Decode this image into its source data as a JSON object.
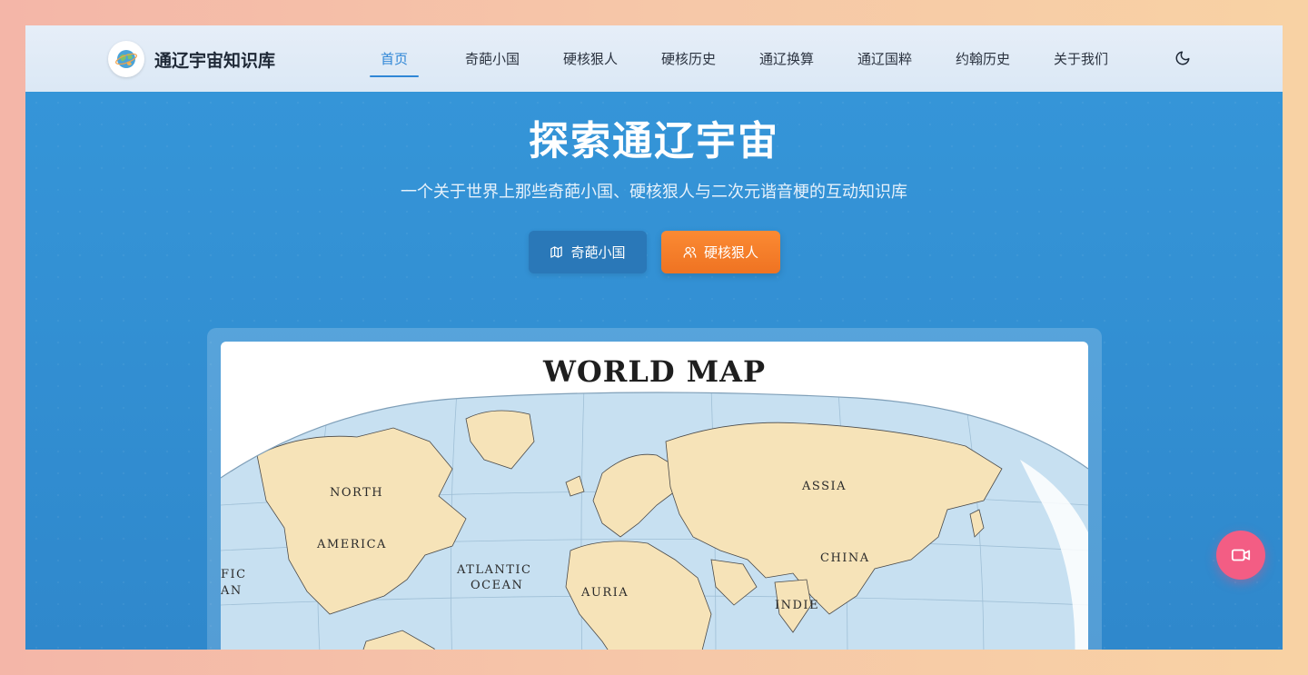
{
  "header": {
    "brand": "通辽宇宙知识库",
    "nav": [
      {
        "label": "首页",
        "active": true
      },
      {
        "label": "奇葩小国"
      },
      {
        "label": "硬核狠人"
      },
      {
        "label": "硬核历史"
      },
      {
        "label": "通辽换算"
      },
      {
        "label": "通辽国粹"
      },
      {
        "label": "约翰历史"
      },
      {
        "label": "关于我们"
      }
    ],
    "theme_icon": "moon-icon"
  },
  "hero": {
    "title": "探索通辽宇宙",
    "subtitle": "一个关于世界上那些奇葩小国、硬核狠人与二次元谐音梗的互动知识库",
    "buttons": {
      "primary": {
        "label": "奇葩小国",
        "icon": "map-icon"
      },
      "accent": {
        "label": "硬核狠人",
        "icon": "users-icon"
      }
    }
  },
  "map": {
    "title": "WORLD MAP",
    "labels": {
      "north": "NORTH",
      "america": "AMERICA",
      "atlantic": "ATLANTIC",
      "ocean": "OCEAN",
      "pacific_partial": "FIC",
      "pacific_ocean_partial": "AN",
      "auoria": "AURIA",
      "assia": "ASSIA",
      "china": "CHINA",
      "indie": "INDIE"
    }
  },
  "floating": {
    "icon": "video-camera-icon"
  },
  "colors": {
    "accent_blue": "#2f86d6",
    "accent_orange": "#f57d2a",
    "float_pink": "#f35d84",
    "land": "#f6e3b8",
    "ocean": "#c5dff0"
  }
}
